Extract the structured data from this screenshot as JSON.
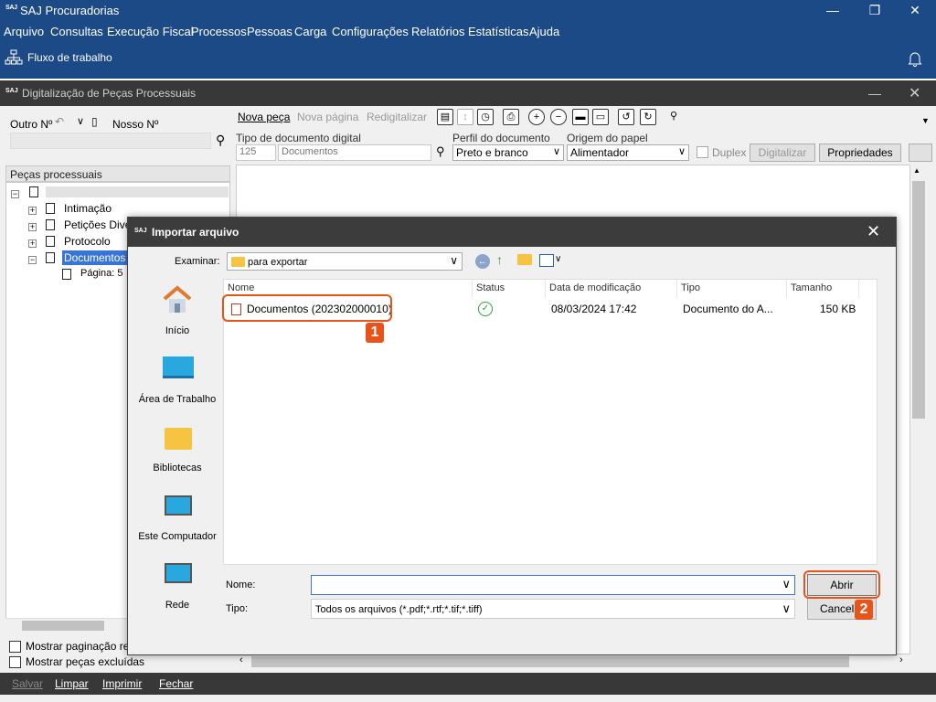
{
  "app": {
    "logo": "SAJ",
    "title": "SAJ Procuradorias",
    "menu": [
      "Arquivo",
      "Consultas",
      "Execução Fiscal",
      "Processos",
      "Pessoas",
      "Carga",
      "Configurações",
      "Relatórios",
      "Estatísticas",
      "Ajuda"
    ],
    "workflow_label": "Fluxo de trabalho"
  },
  "inner_window": {
    "logo": "SAJ",
    "title": "Digitalização de Peças Processuais"
  },
  "left_panel": {
    "outro_label": "Outro Nº",
    "nosso_label": "Nosso Nº",
    "section_title": "Peças processuais",
    "tree": [
      "Intimação",
      "Petições Diversas",
      "Protocolo",
      "Documentos",
      "Página: 5"
    ],
    "checkbox_relative": "Mostrar paginação relativa",
    "checkbox_excluded": "Mostrar peças excluídas"
  },
  "doc_toolbar": {
    "nova_peca": "Nova peça",
    "nova_pagina": "Nova página",
    "redigitalizar": "Redigitalizar"
  },
  "doc_settings": {
    "tipo_label": "Tipo de documento digital",
    "tipo_code": "125",
    "tipo_value": "Documentos",
    "perfil_label": "Perfil do documento",
    "perfil_value": "Preto e branco",
    "origem_label": "Origem do papel",
    "origem_value": "Alimentador",
    "duplex_label": "Duplex",
    "digitalizar_label": "Digitalizar",
    "propriedades_label": "Propriedades"
  },
  "bottom_bar": {
    "salvar": "Salvar",
    "limpar": "Limpar",
    "imprimir": "Imprimir",
    "fechar": "Fechar"
  },
  "dialog": {
    "logo": "SAJ",
    "title": "Importar arquivo",
    "examinar_label": "Examinar:",
    "folder": "para exportar",
    "places": [
      "Início",
      "Área de Trabalho",
      "Bibliotecas",
      "Este Computador",
      "Rede"
    ],
    "columns": [
      "Nome",
      "Status",
      "Data de modificação",
      "Tipo",
      "Tamanho"
    ],
    "files": [
      {
        "name": "Documentos (202302000010)",
        "date": "08/03/2024 17:42",
        "type": "Documento do A...",
        "size": "150 KB"
      }
    ],
    "nome_label": "Nome:",
    "nome_value": "",
    "tipo_label": "Tipo:",
    "tipo_value": "Todos os arquivos (*.pdf;*.rtf;*.tif;*.tiff)",
    "abrir_label": "Abrir",
    "cancelar_label": "Cancelar"
  },
  "annotations": {
    "marker1": "1",
    "marker2": "2",
    "color": "#e8531a"
  }
}
